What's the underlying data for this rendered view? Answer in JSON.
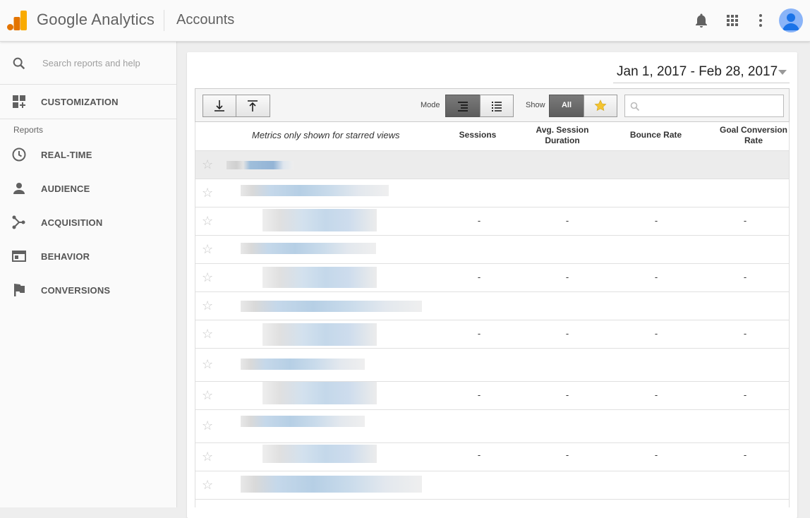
{
  "header": {
    "brand": "Google Analytics",
    "title": "Accounts",
    "icons": [
      "bell-icon",
      "apps-grid-icon",
      "more-vert-icon",
      "account-avatar"
    ]
  },
  "sidebar": {
    "search_placeholder": "Search reports and help",
    "customization_label": "CUSTOMIZATION",
    "reports_label": "Reports",
    "items": [
      {
        "label": "REAL-TIME",
        "icon": "clock-icon"
      },
      {
        "label": "AUDIENCE",
        "icon": "person-icon"
      },
      {
        "label": "ACQUISITION",
        "icon": "acquisition-icon"
      },
      {
        "label": "BEHAVIOR",
        "icon": "behavior-icon"
      },
      {
        "label": "CONVERSIONS",
        "icon": "flag-icon"
      }
    ]
  },
  "main": {
    "date_range": "Jan 1, 2017 - Feb 28, 2017",
    "toolbar": {
      "mode_label": "Mode",
      "show_label": "Show",
      "show_all_label": "All",
      "search_value": ""
    },
    "table": {
      "note": "Metrics only shown for starred views",
      "columns": [
        "Sessions",
        "Avg. Session Duration",
        "Bounce Rate",
        "Goal Conversion Rate"
      ],
      "dash": "-"
    }
  },
  "colors": {
    "accent_orange": "#F9AB00",
    "logo_dark_orange": "#E37400",
    "star_gold": "#F4C430",
    "show_all_button": "#6b6b6b"
  }
}
